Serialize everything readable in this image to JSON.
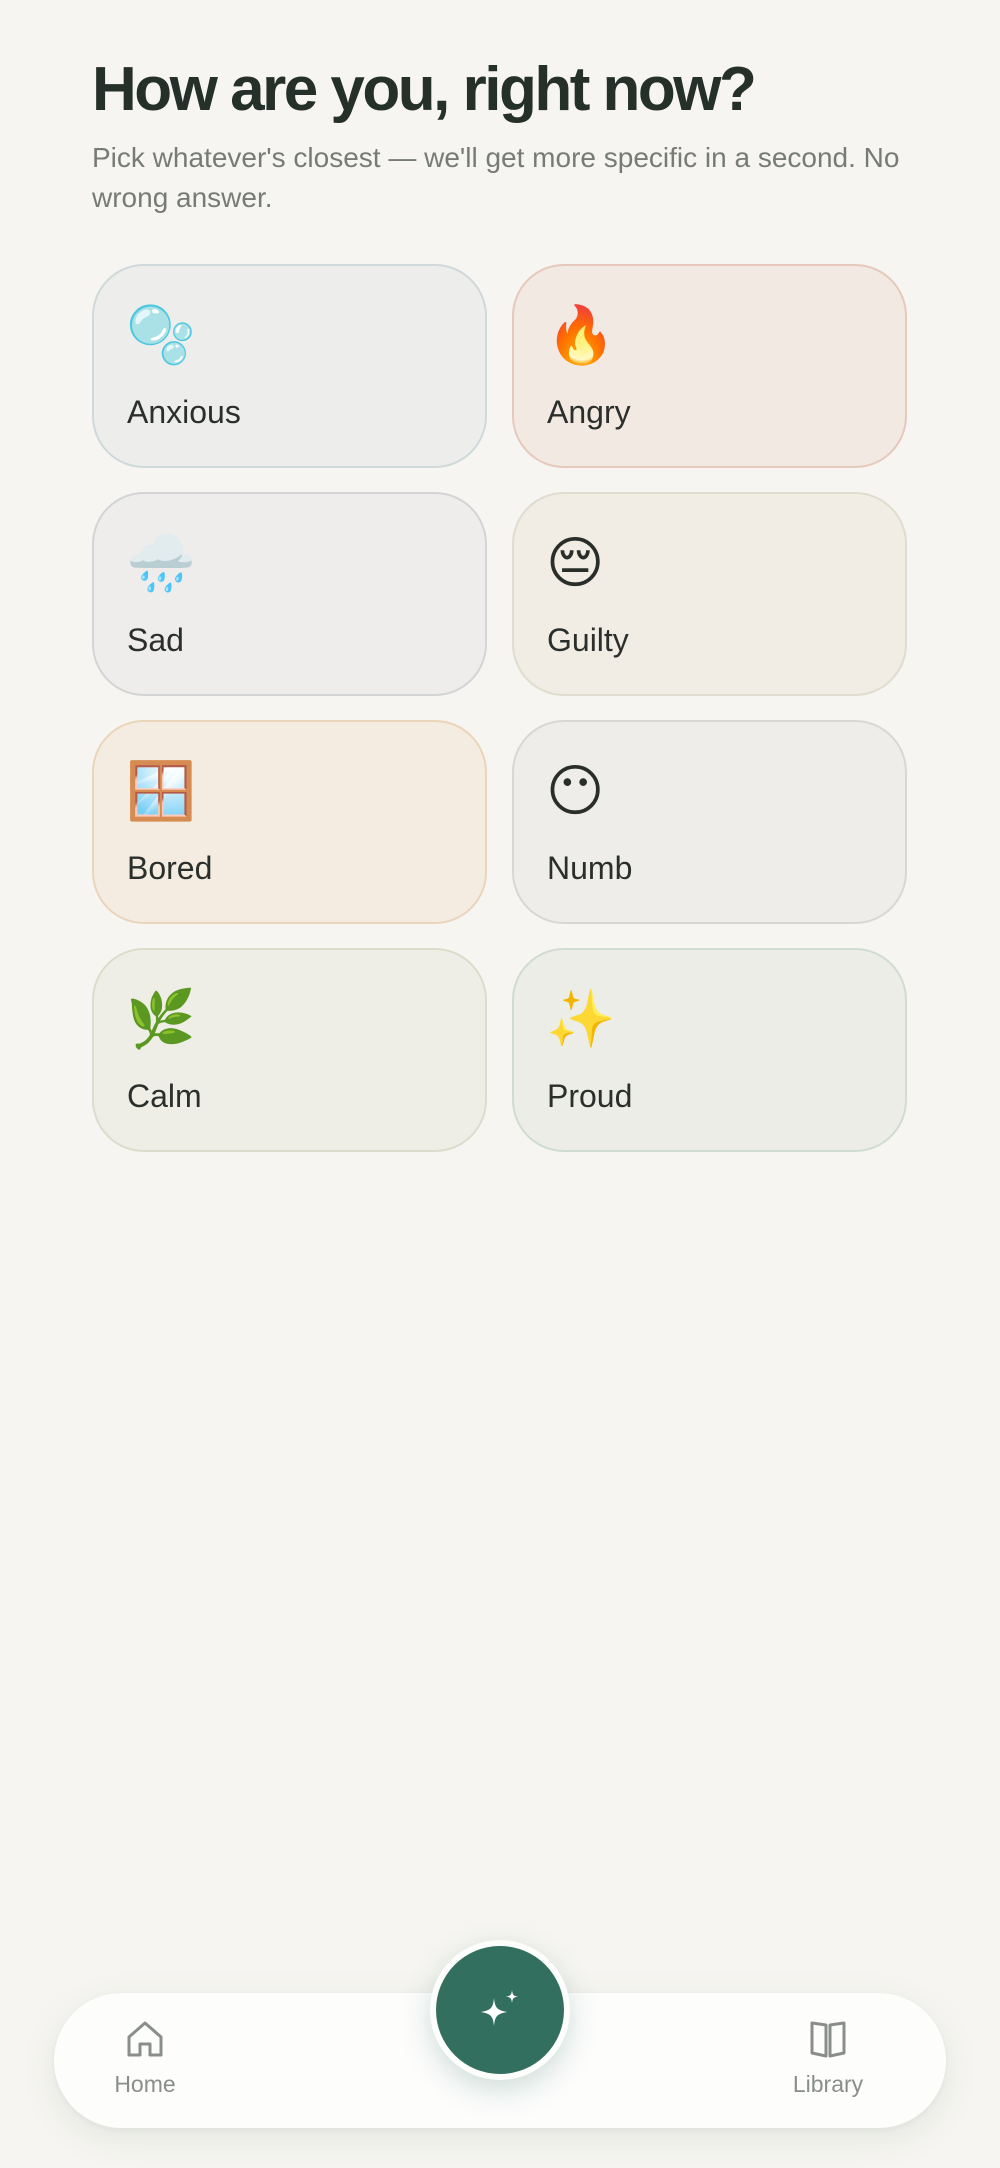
{
  "header": {
    "title": "How are you, right now?",
    "subtitle": "Pick whatever's closest — we'll get more specific in a second. No wrong answer."
  },
  "moods": [
    {
      "label": "Anxious",
      "emoji": "🫧",
      "icon": "bubbles-icon",
      "bg": "#edeeeb",
      "border": "#cfd8db"
    },
    {
      "label": "Angry",
      "emoji": "🔥",
      "icon": "fire-icon",
      "bg": "#f3e9e3",
      "border": "#e6c9bc"
    },
    {
      "label": "Sad",
      "emoji": "🌧️",
      "icon": "rain-cloud-icon",
      "bg": "#eeedeb",
      "border": "#d2d4d5"
    },
    {
      "label": "Guilty",
      "emoji": "😔",
      "icon": "pensive-face-icon",
      "bg": "#f1ede5",
      "border": "#e0dccf"
    },
    {
      "label": "Bored",
      "emoji": "🪟",
      "icon": "window-icon",
      "bg": "#f5ece1",
      "border": "#ead5bb"
    },
    {
      "label": "Numb",
      "emoji": "😶",
      "icon": "no-mouth-face-icon",
      "bg": "#eeede9",
      "border": "#d7d8d3"
    },
    {
      "label": "Calm",
      "emoji": "🌿",
      "icon": "herb-icon",
      "bg": "#efeee6",
      "border": "#dcdccc"
    },
    {
      "label": "Proud",
      "emoji": "✨",
      "icon": "sparkles-icon",
      "bg": "#ecede7",
      "border": "#d0dcd3"
    }
  ],
  "nav": {
    "home_label": "Home",
    "library_label": "Library",
    "fab_icon": "sparkle-icon",
    "accent": "#336f5f"
  }
}
